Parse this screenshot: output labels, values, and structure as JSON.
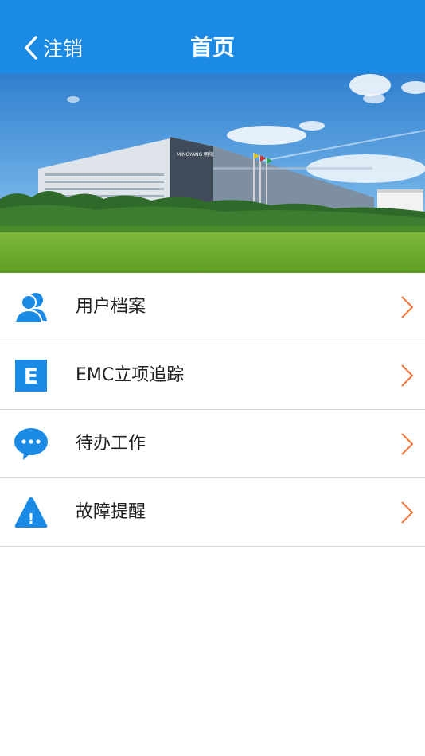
{
  "header": {
    "back_label": "注销",
    "title": "首页"
  },
  "banner": {
    "sign_text": "MINGYANG 明阳"
  },
  "menu": {
    "items": [
      {
        "label": "用户档案",
        "icon": "user-profile-icon"
      },
      {
        "label": "EMC立项追踪",
        "icon": "letter-e-icon",
        "icon_letter": "E"
      },
      {
        "label": "待办工作",
        "icon": "chat-bubble-icon"
      },
      {
        "label": "故障提醒",
        "icon": "warning-icon",
        "icon_glyph": "!"
      }
    ]
  },
  "colors": {
    "primary": "#1a8ae5",
    "arrow": "#f07a3a",
    "divider": "#d9d9d9"
  }
}
